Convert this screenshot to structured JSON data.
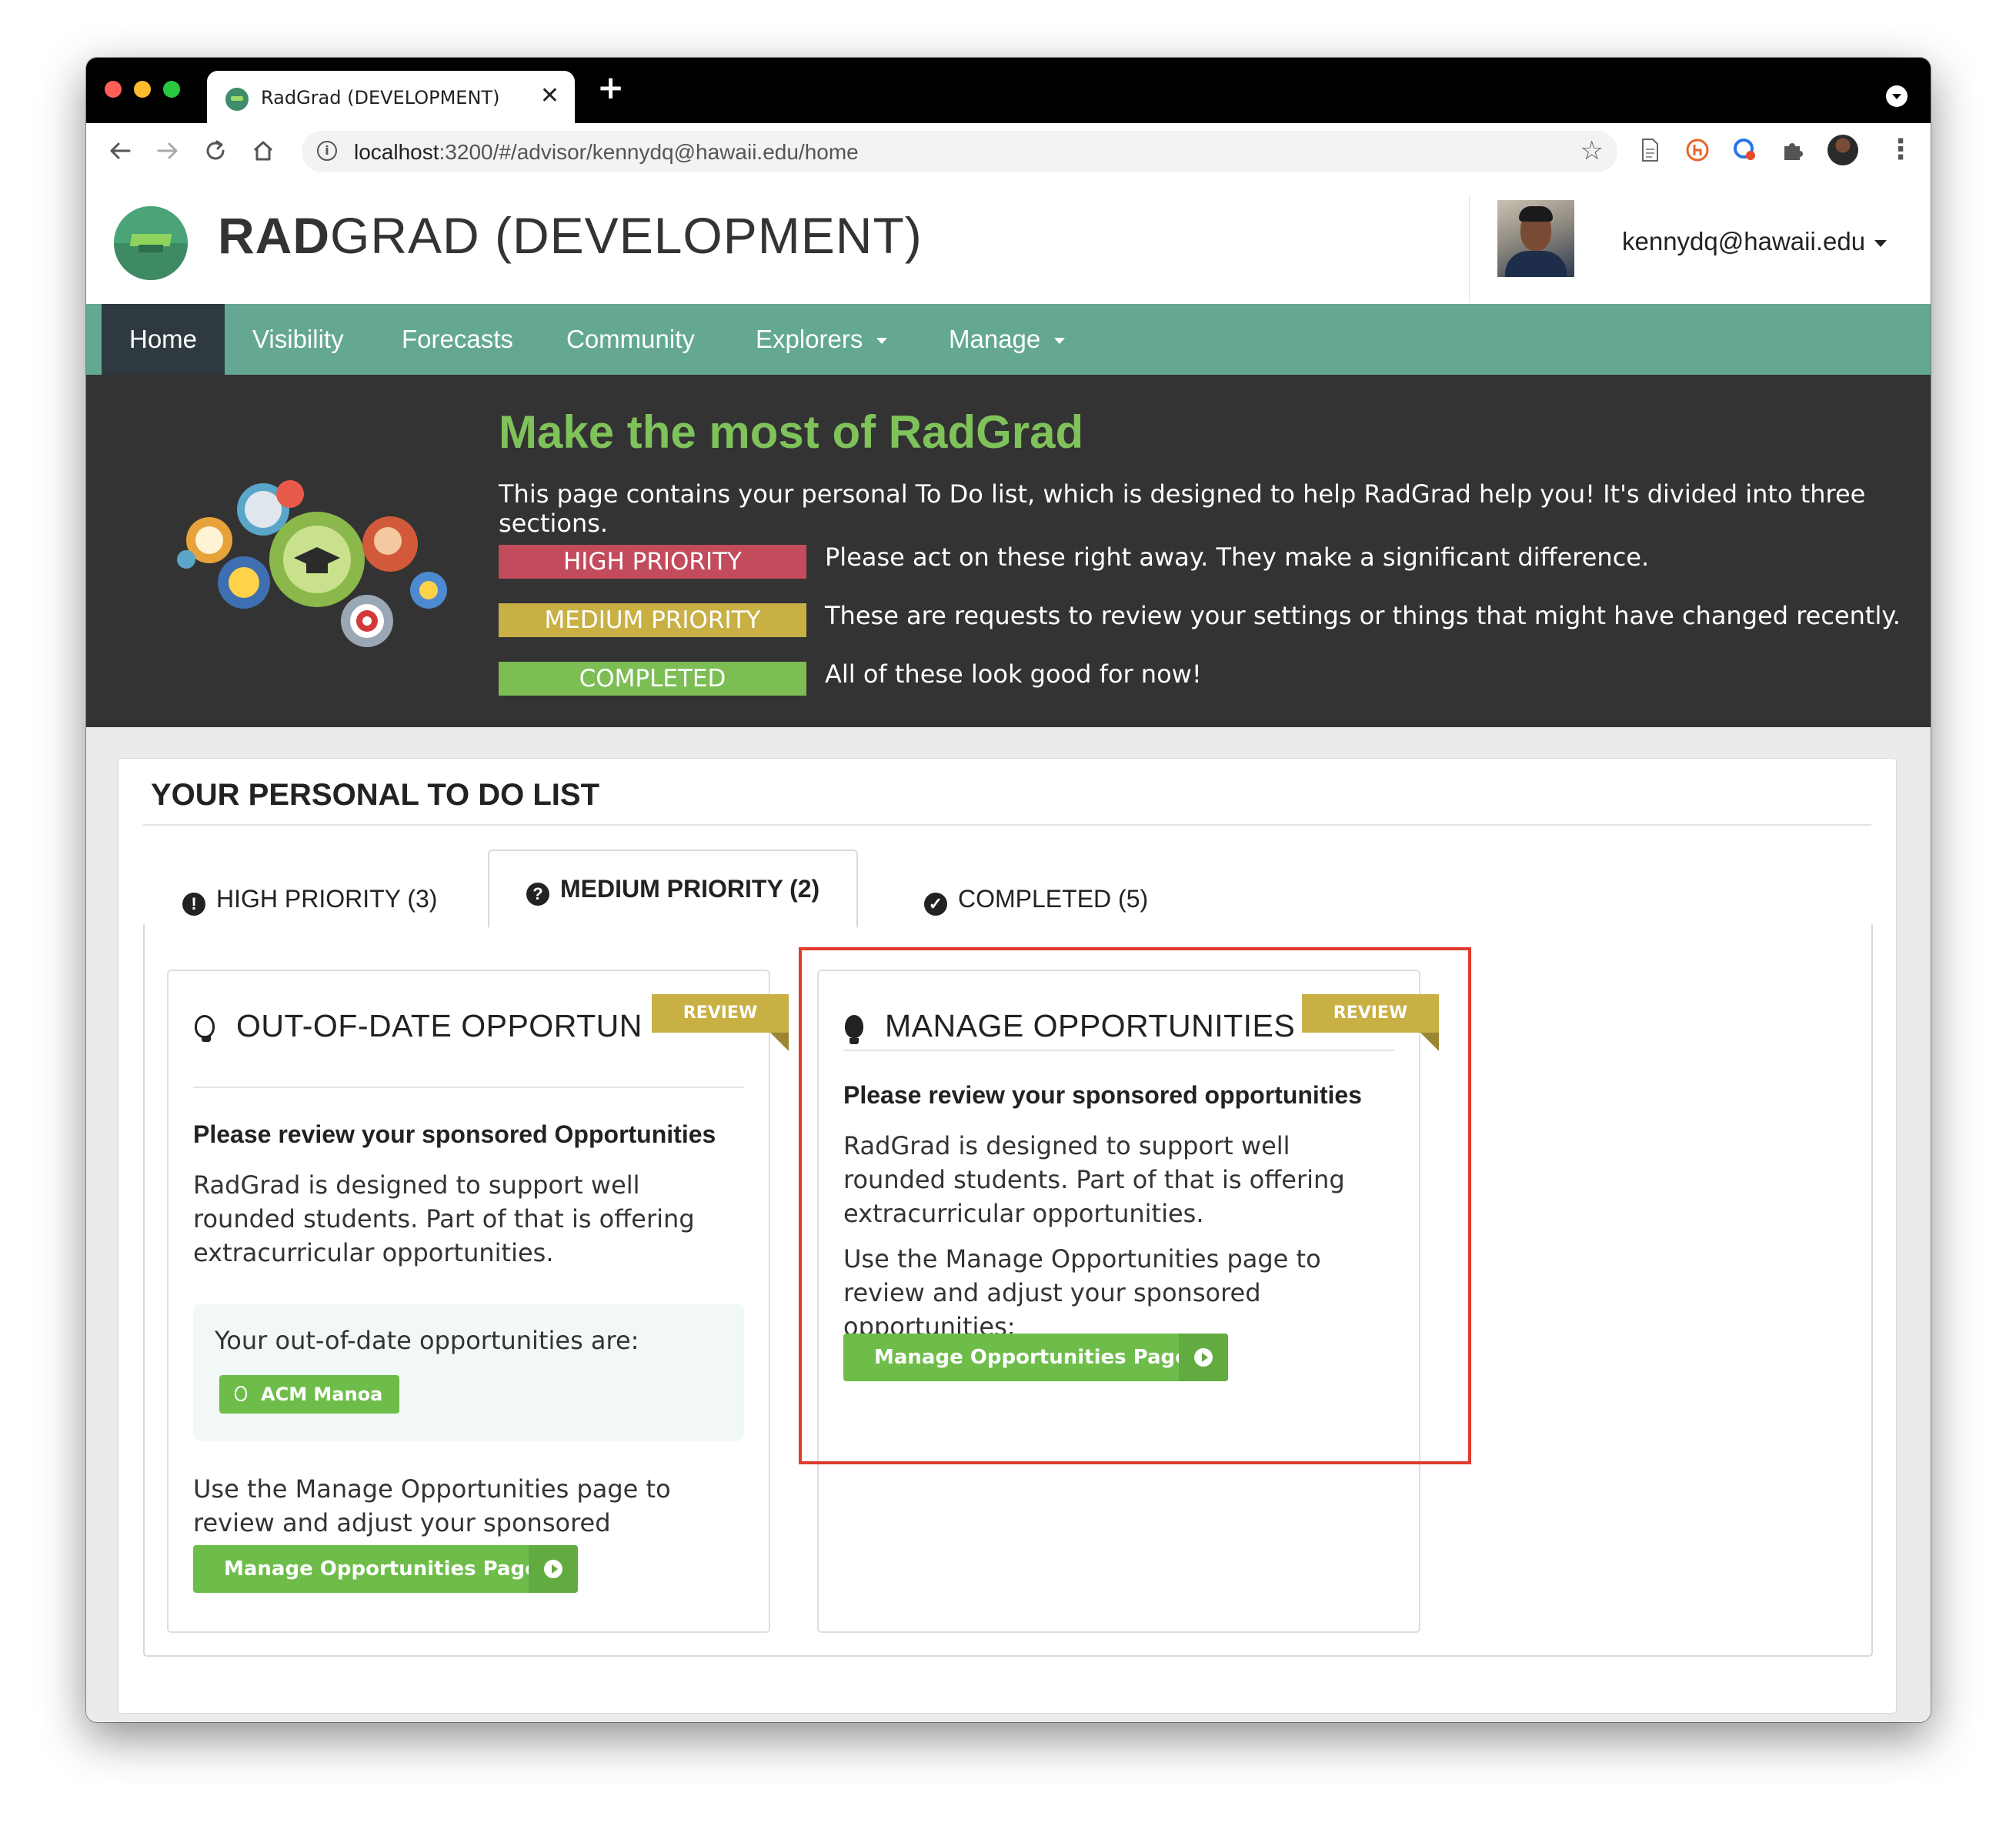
{
  "browser": {
    "tab_title": "RadGrad (DEVELOPMENT)",
    "close_glyph": "✕",
    "new_tab_glyph": "+",
    "url_host": "localhost",
    "url_rest": ":3200/#/advisor/kennydq@hawaii.edu/home"
  },
  "header": {
    "brand_bold": "RAD",
    "brand_rest": "GRAD (DEVELOPMENT)",
    "user_email": "kennydq@hawaii.edu"
  },
  "nav": {
    "items": [
      {
        "label": "Home",
        "active": true
      },
      {
        "label": "Visibility"
      },
      {
        "label": "Forecasts"
      },
      {
        "label": "Community"
      },
      {
        "label": "Explorers",
        "dropdown": true
      },
      {
        "label": "Manage",
        "dropdown": true
      }
    ]
  },
  "banner": {
    "title": "Make the most of RadGrad",
    "intro": "This page contains your personal To Do list, which is designed to help RadGrad help you! It's divided into three sections.",
    "priorities": [
      {
        "label": "HIGH PRIORITY",
        "color": "#c24b5c",
        "desc": "Please act on these right away. They make a significant difference."
      },
      {
        "label": "MEDIUM PRIORITY",
        "color": "#c8b045",
        "desc": "These are requests to review your settings or things that might have changed recently."
      },
      {
        "label": "COMPLETED",
        "color": "#7cbd54",
        "desc": "All of these look good for now!"
      }
    ]
  },
  "todo": {
    "title": "YOUR PERSONAL TO DO LIST",
    "tabs": [
      {
        "label": "HIGH PRIORITY (3)",
        "icon": "exclamation-circle-icon"
      },
      {
        "label": "MEDIUM PRIORITY (2)",
        "icon": "question-circle-icon",
        "active": true
      },
      {
        "label": "COMPLETED (5)",
        "icon": "check-circle-icon"
      }
    ]
  },
  "cards": [
    {
      "title": "OUT-OF-DATE OPPORTUN",
      "ribbon": "REVIEW",
      "subtitle": "Please review your sponsored Opportunities",
      "text1": "RadGrad is designed to support well rounded students. Part of that is offering extracurricular opportunities.",
      "box_label": "Your out-of-date opportunities are:",
      "chip": "ACM Manoa",
      "text2": "Use the Manage Opportunities page to review and adjust your sponsored opportunities:",
      "button": "Manage Opportunities Page"
    },
    {
      "title": "MANAGE OPPORTUNITIES",
      "ribbon": "REVIEW",
      "subtitle": "Please review your sponsored opportunities",
      "text1": "RadGrad is designed to support well rounded students. Part of that is offering extracurricular opportunities.",
      "text2": "Use the Manage Opportunities page to review and adjust your sponsored opportunities:",
      "button": "Manage Opportunities Page"
    }
  ],
  "colors": {
    "nav": "#64a893",
    "banner": "#333333",
    "accent_green": "#7fc25a",
    "annotation_red": "#e03c2d"
  }
}
